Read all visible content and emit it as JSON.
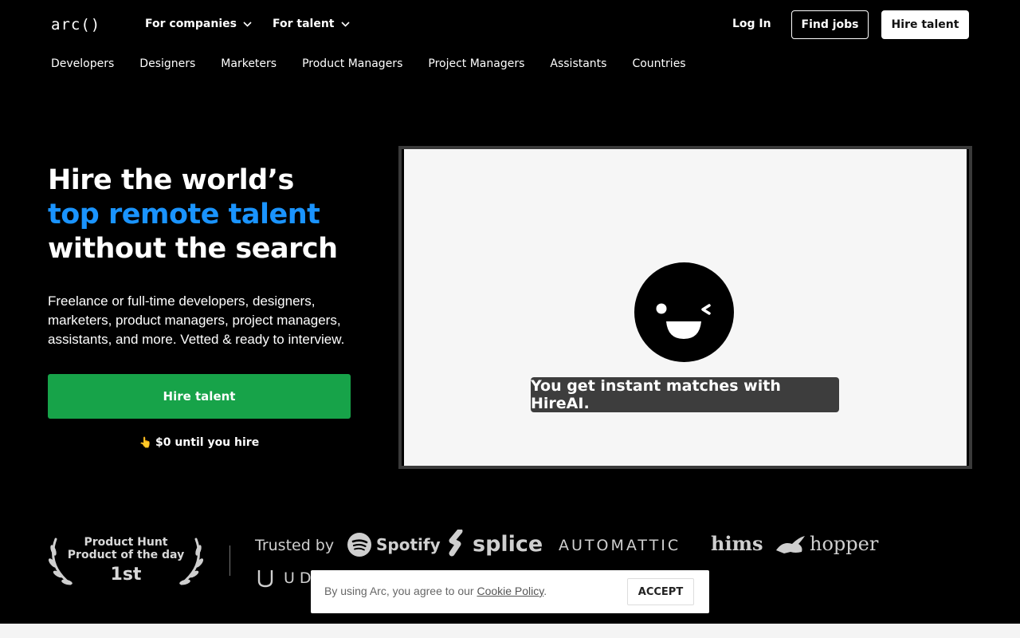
{
  "header": {
    "logo": "arc()",
    "menus": [
      {
        "label": "For companies",
        "icon": "chevron-down-icon"
      },
      {
        "label": "For talent",
        "icon": "chevron-down-icon"
      }
    ],
    "login_label": "Log In",
    "find_jobs_label": "Find jobs",
    "hire_talent_label": "Hire talent"
  },
  "subnav": [
    "Developers",
    "Designers",
    "Marketers",
    "Product Managers",
    "Project Managers",
    "Assistants",
    "Countries"
  ],
  "hero": {
    "title_line1": "Hire the world’s",
    "title_line2": "top remote talent",
    "title_line3": "without the search",
    "description": "Freelance or full-time developers, designers, marketers, product managers, project managers, assistants, and more. Vetted & ready to interview.",
    "cta_label": "Hire talent",
    "note_icon": "👆",
    "note": "$0 until you hire",
    "accent_color": "#1a94ff",
    "cta_color": "#17a349"
  },
  "video": {
    "caption": "You get instant matches with HireAI.",
    "icon": "winking-face-icon"
  },
  "trust": {
    "product_hunt_line1": "Product Hunt",
    "product_hunt_line2": "Product of the day",
    "product_hunt_rank": "1st",
    "trusted_label": "Trusted by",
    "brands": {
      "spotify": "Spotify",
      "splice": "splice",
      "automattic": "AUTOMATTIC",
      "hims": "hims",
      "hopper": "hopper",
      "udacity": "UD"
    }
  },
  "cookie": {
    "text": "By using Arc, you agree to our ",
    "link": "Cookie Policy",
    "suffix": ".",
    "accept_label": "ACCEPT"
  }
}
